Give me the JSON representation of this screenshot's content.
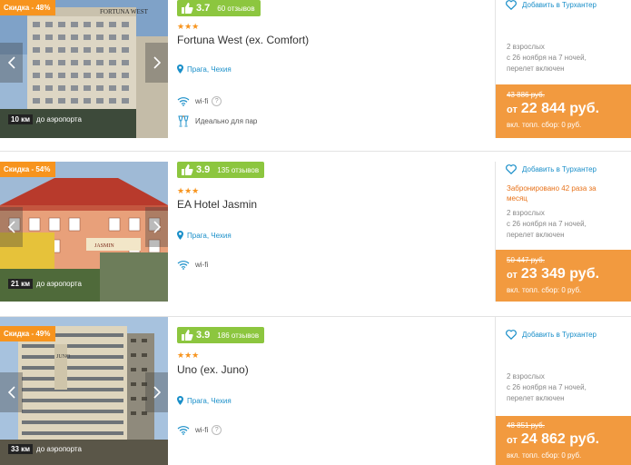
{
  "hotels": [
    {
      "discount": "Скидка - 48%",
      "airport_km": "10 км",
      "airport_label": "до аэропорта",
      "score": "3.7",
      "reviews": "60 отзывов",
      "stars": "★★★",
      "name": "Fortuna West (ex. Comfort)",
      "location": "Прага, Чехия",
      "amenities": [
        "wi-fi",
        "Идеально для пар"
      ],
      "favorite": "Добавить в Турхантер",
      "booked": "",
      "details": [
        "2 взрослых",
        "с 26 ноября на 7 ночей,",
        "перелет включен"
      ],
      "old_price": "43 886 руб.",
      "price_from": "от",
      "price": "22 844 руб.",
      "price_note": "вкл. топл. сбор: 0 руб."
    },
    {
      "discount": "Скидка - 54%",
      "airport_km": "21 км",
      "airport_label": "до аэропорта",
      "score": "3.9",
      "reviews": "135 отзывов",
      "stars": "★★★",
      "name": "EA Hotel Jasmin",
      "location": "Прага, Чехия",
      "amenities": [
        "wi-fi"
      ],
      "favorite": "Добавить в Турхантер",
      "booked": "Забронировано 42 раза за месяц",
      "details": [
        "2 взрослых",
        "с 26 ноября на 7 ночей,",
        "перелет включен"
      ],
      "old_price": "50 447 руб.",
      "price_from": "от",
      "price": "23 349 руб.",
      "price_note": "вкл. топл. сбор: 0 руб."
    },
    {
      "discount": "Скидка - 49%",
      "airport_km": "33 км",
      "airport_label": "до аэропорта",
      "score": "3.9",
      "reviews": "186 отзывов",
      "stars": "★★★",
      "name": "Uno (ex. Juno)",
      "location": "Прага, Чехия",
      "amenities": [
        "wi-fi"
      ],
      "favorite": "Добавить в Турхантер",
      "booked": "",
      "details": [
        "2 взрослых",
        "с 26 ноября на 7 ночей,",
        "перелет включен"
      ],
      "old_price": "48 851 руб.",
      "price_from": "от",
      "price": "24 862 руб.",
      "price_note": "вкл. топл. сбор: 0 руб."
    }
  ],
  "photo_signs": [
    "FORTUNA WEST",
    "JASMIN",
    "JUNO"
  ],
  "colors": {
    "accent_orange": "#f29a3f",
    "rating_green": "#8cc63f",
    "link_blue": "#1a8fc9",
    "booked_orange": "#e8731b"
  }
}
